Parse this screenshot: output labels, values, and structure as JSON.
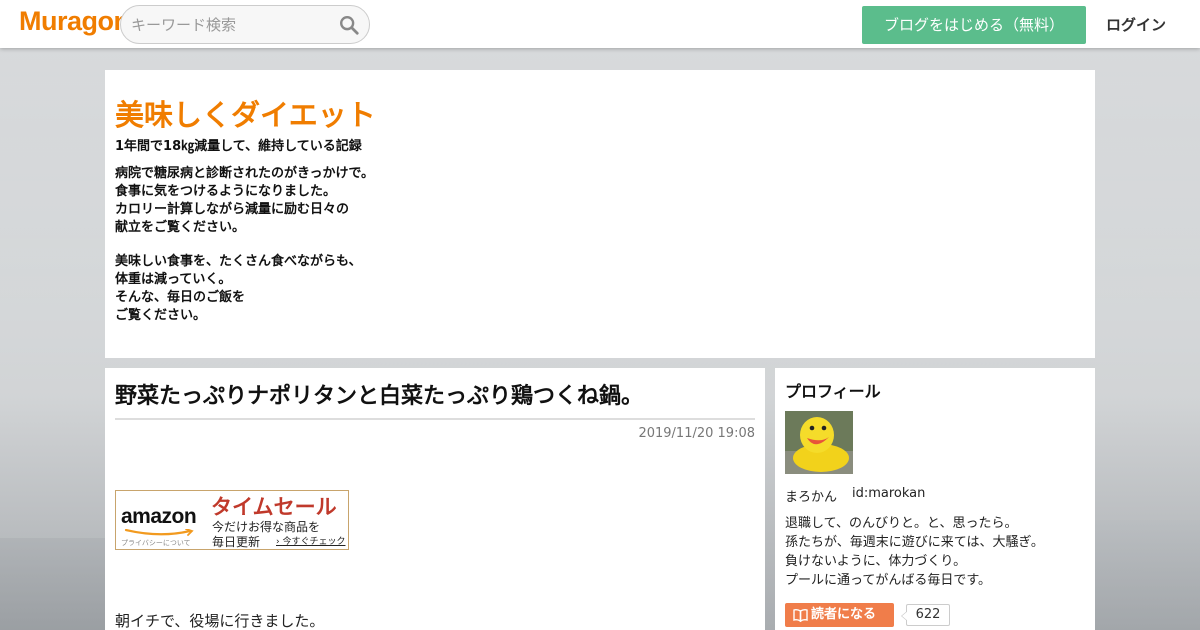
{
  "header": {
    "logo_text": "Muragon",
    "search_placeholder": "キーワード検索",
    "start_blog_label": "ブログをはじめる（無料）",
    "login_label": "ログイン",
    "colors": {
      "brand": "#f07d00",
      "start_button": "#5bbd8c"
    }
  },
  "blog": {
    "title": "美味しくダイエット",
    "subtitle": "1年間で18㎏減量して、維持している記録",
    "description_lines_1": [
      "病院で糖尿病と診断されたのがきっかけで。",
      "食事に気をつけるようになりました。",
      "カロリー計算しながら減量に励む日々の",
      "献立をご覧ください。"
    ],
    "description_lines_2": [
      "美味しい食事を、たくさん食べながらも、",
      "体重は減っていく。",
      "そんな、毎日のご飯を",
      "ご覧ください。"
    ]
  },
  "article": {
    "title": "野菜たっぷりナポリタンと白菜たっぷり鶏つくね鍋。",
    "date": "2019/11/20 19:08",
    "body_first_line": "朝イチで、役場に行きました。"
  },
  "ad": {
    "brand": "amazon",
    "privacy": "プライバシーについて",
    "headline": "タイムセール",
    "line1": "今だけお得な商品を",
    "line2": "毎日更新",
    "check_label": "今すぐチェック"
  },
  "profile": {
    "heading": "プロフィール",
    "name": "まろかん",
    "user_id": "id:marokan",
    "bio_lines": [
      "退職して、のんびりと。と、思ったら。",
      "孫たちが、毎週末に遊びに来ては、大騒ぎ。",
      "負けないように、体力づくり。",
      "プールに通ってがんばる毎日です。"
    ],
    "follow_label": "読者になる",
    "reader_count": "622",
    "colors": {
      "follow_button": "#f07d4a"
    }
  }
}
